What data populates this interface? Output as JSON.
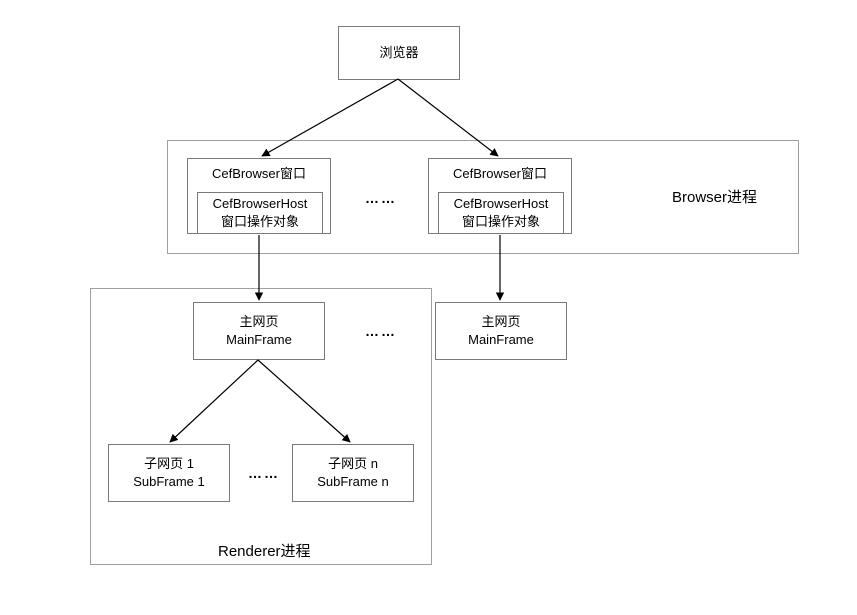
{
  "nodes": {
    "browser": {
      "line1": "浏览器"
    },
    "cef_left": {
      "line1": "CefBrowser窗口",
      "line2": "CefBrowserHost",
      "line3": "窗口操作对象"
    },
    "cef_right": {
      "line1": "CefBrowser窗口",
      "line2": "CefBrowserHost",
      "line3": "窗口操作对象"
    },
    "main_left": {
      "line1": "主网页",
      "line2": "MainFrame"
    },
    "main_right": {
      "line1": "主网页",
      "line2": "MainFrame"
    },
    "sub_left": {
      "line1": "子网页 1",
      "line2": "SubFrame 1"
    },
    "sub_right": {
      "line1": "子网页 n",
      "line2": "SubFrame n"
    }
  },
  "containers": {
    "browser_proc": "Browser进程",
    "renderer_proc": "Renderer进程"
  },
  "ellipsis": "……"
}
